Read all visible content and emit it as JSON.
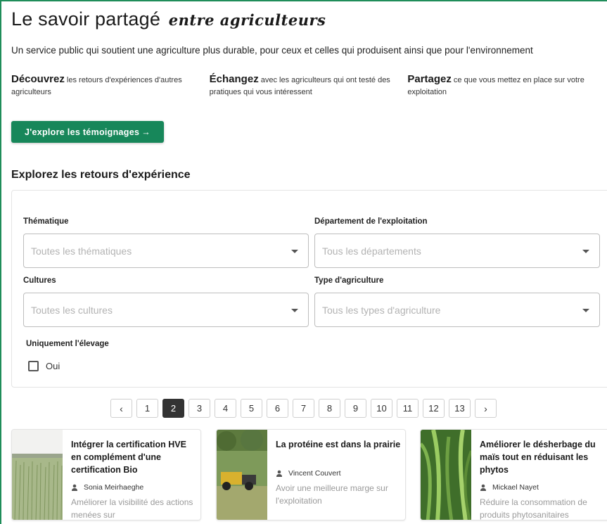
{
  "header": {
    "title_main": "Le savoir partagé",
    "title_script": "entre agriculteurs",
    "subtitle": "Un service public qui soutient une agriculture plus durable, pour ceux et celles qui produisent ainsi que pour l'environnement"
  },
  "features": [
    {
      "bold": "Découvrez",
      "text": " les retours d'expériences d'autres agriculteurs"
    },
    {
      "bold": "Échangez",
      "text": " avec les agriculteurs qui ont testé des pratiques qui vous intéressent"
    },
    {
      "bold": "Partagez",
      "text": " ce que vous mettez en place sur votre exploitation"
    }
  ],
  "cta": {
    "label": "J'explore les témoignages",
    "arrow": "→"
  },
  "section": {
    "title": "Explorez les retours d'expérience"
  },
  "filters": {
    "thematique": {
      "label": "Thématique",
      "placeholder": "Toutes les thématiques"
    },
    "departement": {
      "label": "Département de l'exploitation",
      "placeholder": "Tous les départements"
    },
    "cultures": {
      "label": "Cultures",
      "placeholder": "Toutes les cultures"
    },
    "type": {
      "label": "Type d'agriculture",
      "placeholder": "Tous les types d'agriculture"
    },
    "elevage": {
      "label": "Uniquement l'élevage",
      "option": "Oui",
      "checked": false
    }
  },
  "pagination": {
    "prev": "‹",
    "next": "›",
    "pages": [
      "1",
      "2",
      "3",
      "4",
      "5",
      "6",
      "7",
      "8",
      "9",
      "10",
      "11",
      "12",
      "13"
    ],
    "current": "2"
  },
  "cards": [
    {
      "title": "Intégrer la certification HVE en complément d'une certification Bio",
      "author": "Sonia Meirhaeghe",
      "description": "Améliorer la visibilité des actions menées sur",
      "image": "wheat-field"
    },
    {
      "title": "La protéine est dans la prairie",
      "author": "Vincent Couvert",
      "description": "Avoir une meilleure marge sur l'exploitation",
      "image": "tractor-hay"
    },
    {
      "title": "Améliorer le désherbage du maïs tout en réduisant les phytos",
      "author": "Mickael Nayet",
      "description": "Réduire la consommation de produits phytosanitaires",
      "image": "corn-field"
    }
  ],
  "colors": {
    "accent": "#17875a",
    "active_page": "#333333"
  }
}
